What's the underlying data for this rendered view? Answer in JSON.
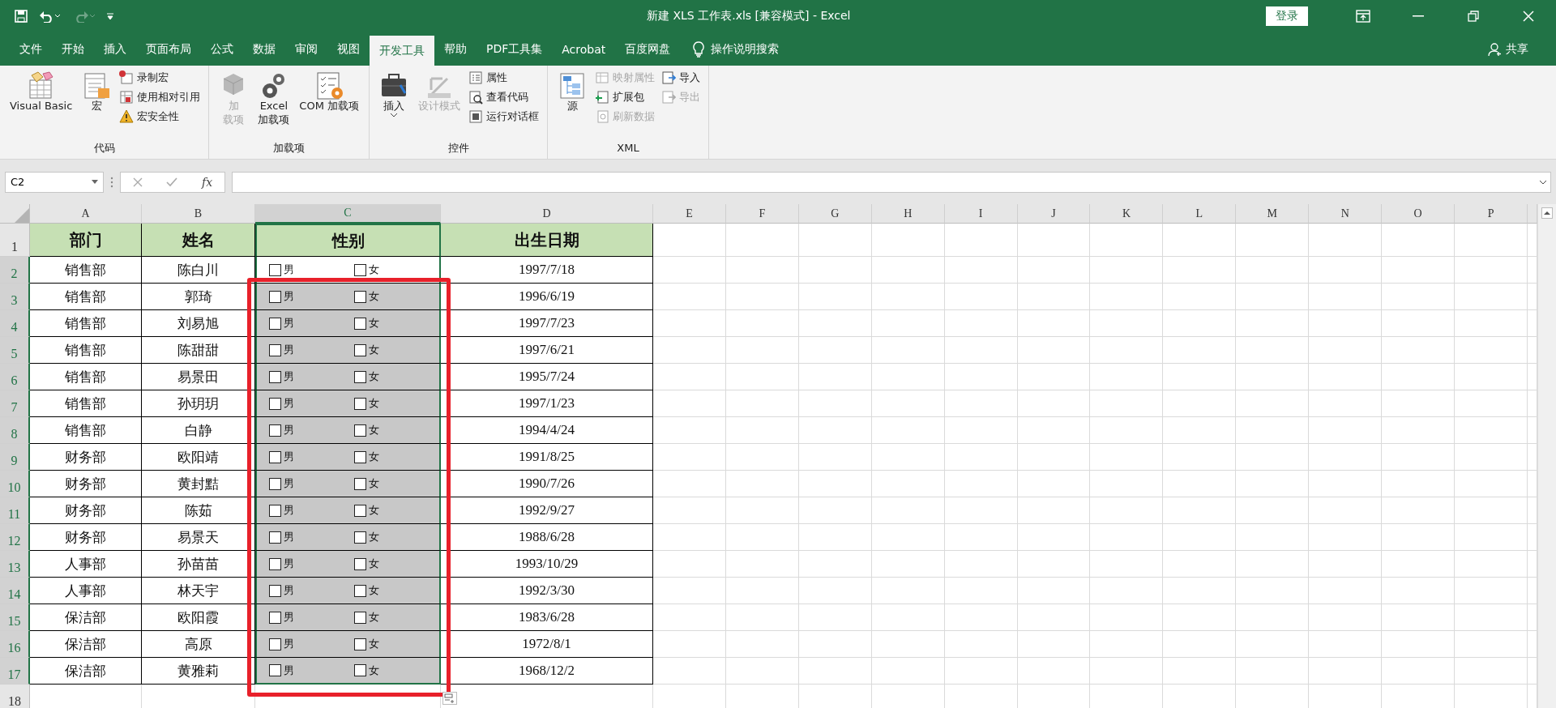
{
  "title_bar": {
    "title": "新建 XLS 工作表.xls  [兼容模式]  -  Excel",
    "login_button": "登录"
  },
  "tabs": [
    {
      "label": "文件",
      "selected": false
    },
    {
      "label": "开始",
      "selected": false
    },
    {
      "label": "插入",
      "selected": false
    },
    {
      "label": "页面布局",
      "selected": false
    },
    {
      "label": "公式",
      "selected": false
    },
    {
      "label": "数据",
      "selected": false
    },
    {
      "label": "审阅",
      "selected": false
    },
    {
      "label": "视图",
      "selected": false
    },
    {
      "label": "开发工具",
      "selected": true
    },
    {
      "label": "帮助",
      "selected": false
    },
    {
      "label": "PDF工具集",
      "selected": false
    },
    {
      "label": "Acrobat",
      "selected": false
    },
    {
      "label": "百度网盘",
      "selected": false
    }
  ],
  "tell_me": "操作说明搜索",
  "share": "共享",
  "ribbon_groups": [
    {
      "label": "代码",
      "items": [
        {
          "kind": "large",
          "lines": [
            "Visual Basic"
          ],
          "disabled": false,
          "dropdown": false
        },
        {
          "kind": "large",
          "lines": [
            "宏"
          ],
          "disabled": false,
          "dropdown": false
        },
        {
          "kind": "stack",
          "entries": [
            {
              "label": "录制宏",
              "disabled": false
            },
            {
              "label": "使用相对引用",
              "disabled": false
            },
            {
              "label": "宏安全性",
              "disabled": false
            }
          ]
        }
      ]
    },
    {
      "label": "加载项",
      "items": [
        {
          "kind": "large",
          "lines": [
            "加",
            "载项"
          ],
          "disabled": true,
          "dropdown": false
        },
        {
          "kind": "large",
          "lines": [
            "Excel",
            "加载项"
          ],
          "disabled": false,
          "dropdown": false
        },
        {
          "kind": "large",
          "lines": [
            "COM 加载项"
          ],
          "disabled": false,
          "dropdown": false
        }
      ]
    },
    {
      "label": "控件",
      "items": [
        {
          "kind": "large",
          "lines": [
            "插入"
          ],
          "disabled": false,
          "dropdown": true
        },
        {
          "kind": "large",
          "lines": [
            "设计模式"
          ],
          "disabled": true,
          "dropdown": false
        },
        {
          "kind": "stack",
          "entries": [
            {
              "label": "属性",
              "disabled": false
            },
            {
              "label": "查看代码",
              "disabled": false
            },
            {
              "label": "运行对话框",
              "disabled": false
            }
          ]
        }
      ]
    },
    {
      "label": "XML",
      "items": [
        {
          "kind": "large",
          "lines": [
            "源"
          ],
          "disabled": false,
          "dropdown": false
        },
        {
          "kind": "stack",
          "entries": [
            {
              "label": "映射属性",
              "disabled": true
            },
            {
              "label": "扩展包",
              "disabled": false
            },
            {
              "label": "刷新数据",
              "disabled": true
            }
          ]
        },
        {
          "kind": "stack",
          "entries": [
            {
              "label": "导入",
              "disabled": false
            },
            {
              "label": "导出",
              "disabled": true
            }
          ]
        }
      ]
    }
  ],
  "formula_bar": {
    "name_box": "C2",
    "fx": "fx"
  },
  "columns": [
    {
      "label": "A",
      "selected": false
    },
    {
      "label": "B",
      "selected": false
    },
    {
      "label": "C",
      "selected": true
    },
    {
      "label": "D",
      "selected": false
    },
    {
      "label": "E",
      "selected": false
    },
    {
      "label": "F",
      "selected": false
    },
    {
      "label": "G",
      "selected": false
    },
    {
      "label": "H",
      "selected": false
    },
    {
      "label": "I",
      "selected": false
    },
    {
      "label": "J",
      "selected": false
    },
    {
      "label": "K",
      "selected": false
    },
    {
      "label": "L",
      "selected": false
    },
    {
      "label": "M",
      "selected": false
    },
    {
      "label": "N",
      "selected": false
    },
    {
      "label": "O",
      "selected": false
    },
    {
      "label": "P",
      "selected": false
    }
  ],
  "header_row": {
    "row": "1",
    "selected": false,
    "cells": [
      "部门",
      "姓名",
      "性别",
      "出生日期"
    ]
  },
  "rows": [
    {
      "row": "2",
      "selected": true,
      "department": "销售部",
      "name": "陈白川",
      "controls_selected": false,
      "options": [
        {
          "label": "男",
          "checked": false
        },
        {
          "label": "女",
          "checked": false
        }
      ],
      "birth_date": "1997/7/18"
    },
    {
      "row": "3",
      "selected": true,
      "department": "销售部",
      "name": "郭琦",
      "controls_selected": true,
      "options": [
        {
          "label": "男",
          "checked": false
        },
        {
          "label": "女",
          "checked": false
        }
      ],
      "birth_date": "1996/6/19"
    },
    {
      "row": "4",
      "selected": true,
      "department": "销售部",
      "name": "刘易旭",
      "controls_selected": true,
      "options": [
        {
          "label": "男",
          "checked": false
        },
        {
          "label": "女",
          "checked": false
        }
      ],
      "birth_date": "1997/7/23"
    },
    {
      "row": "5",
      "selected": true,
      "department": "销售部",
      "name": "陈甜甜",
      "controls_selected": true,
      "options": [
        {
          "label": "男",
          "checked": false
        },
        {
          "label": "女",
          "checked": false
        }
      ],
      "birth_date": "1997/6/21"
    },
    {
      "row": "6",
      "selected": true,
      "department": "销售部",
      "name": "易景田",
      "controls_selected": true,
      "options": [
        {
          "label": "男",
          "checked": false
        },
        {
          "label": "女",
          "checked": false
        }
      ],
      "birth_date": "1995/7/24"
    },
    {
      "row": "7",
      "selected": true,
      "department": "销售部",
      "name": "孙玥玥",
      "controls_selected": true,
      "options": [
        {
          "label": "男",
          "checked": false
        },
        {
          "label": "女",
          "checked": false
        }
      ],
      "birth_date": "1997/1/23"
    },
    {
      "row": "8",
      "selected": true,
      "department": "销售部",
      "name": "白静",
      "controls_selected": true,
      "options": [
        {
          "label": "男",
          "checked": false
        },
        {
          "label": "女",
          "checked": false
        }
      ],
      "birth_date": "1994/4/24"
    },
    {
      "row": "9",
      "selected": true,
      "department": "财务部",
      "name": "欧阳靖",
      "controls_selected": true,
      "options": [
        {
          "label": "男",
          "checked": false
        },
        {
          "label": "女",
          "checked": false
        }
      ],
      "birth_date": "1991/8/25"
    },
    {
      "row": "10",
      "selected": true,
      "department": "财务部",
      "name": "黄封黠",
      "controls_selected": true,
      "options": [
        {
          "label": "男",
          "checked": false
        },
        {
          "label": "女",
          "checked": false
        }
      ],
      "birth_date": "1990/7/26"
    },
    {
      "row": "11",
      "selected": true,
      "department": "财务部",
      "name": "陈茹",
      "controls_selected": true,
      "options": [
        {
          "label": "男",
          "checked": false
        },
        {
          "label": "女",
          "checked": false
        }
      ],
      "birth_date": "1992/9/27"
    },
    {
      "row": "12",
      "selected": true,
      "department": "财务部",
      "name": "易景天",
      "controls_selected": true,
      "options": [
        {
          "label": "男",
          "checked": false
        },
        {
          "label": "女",
          "checked": false
        }
      ],
      "birth_date": "1988/6/28"
    },
    {
      "row": "13",
      "selected": true,
      "department": "人事部",
      "name": "孙苗苗",
      "controls_selected": true,
      "options": [
        {
          "label": "男",
          "checked": false
        },
        {
          "label": "女",
          "checked": false
        }
      ],
      "birth_date": "1993/10/29"
    },
    {
      "row": "14",
      "selected": true,
      "department": "人事部",
      "name": "林天宇",
      "controls_selected": true,
      "options": [
        {
          "label": "男",
          "checked": false
        },
        {
          "label": "女",
          "checked": false
        }
      ],
      "birth_date": "1992/3/30"
    },
    {
      "row": "15",
      "selected": true,
      "department": "保洁部",
      "name": "欧阳霞",
      "controls_selected": true,
      "options": [
        {
          "label": "男",
          "checked": false
        },
        {
          "label": "女",
          "checked": false
        }
      ],
      "birth_date": "1983/6/28"
    },
    {
      "row": "16",
      "selected": true,
      "department": "保洁部",
      "name": "高原",
      "controls_selected": true,
      "options": [
        {
          "label": "男",
          "checked": false
        },
        {
          "label": "女",
          "checked": false
        }
      ],
      "birth_date": "1972/8/1"
    },
    {
      "row": "17",
      "selected": true,
      "department": "保洁部",
      "name": "黄雅莉",
      "controls_selected": true,
      "options": [
        {
          "label": "男",
          "checked": false
        },
        {
          "label": "女",
          "checked": false
        }
      ],
      "birth_date": "1968/12/2"
    }
  ],
  "empty_rows": [
    {
      "row": "18",
      "selected": false
    }
  ]
}
